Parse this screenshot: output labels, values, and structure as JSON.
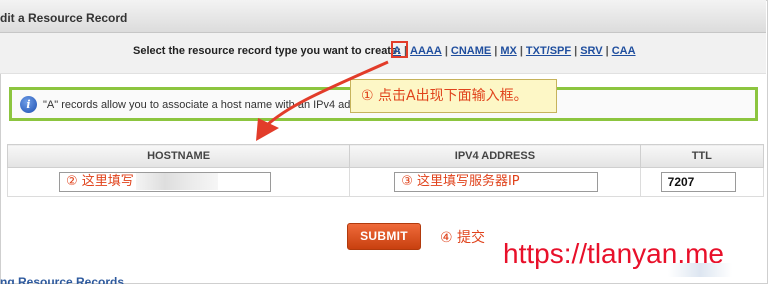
{
  "header": {
    "title": "dit a Resource Record"
  },
  "type_selector": {
    "prompt": "Select the resource record type you want to create:",
    "types": [
      "A",
      "AAAA",
      "CNAME",
      "MX",
      "TXT/SPF",
      "SRV",
      "CAA"
    ],
    "selected": "A"
  },
  "info": {
    "text": "\"A\" records allow you to associate a host name with an IPv4 addr"
  },
  "annotations": {
    "step1": "① 点击A出现下面输入框。",
    "step2": "② 这里填写 www.",
    "step3": "③ 这里填写服务器IP",
    "step4": "④ 提交"
  },
  "table": {
    "columns": [
      "HOSTNAME",
      "IPV4 ADDRESS",
      "TTL"
    ],
    "ttl_value": "7207"
  },
  "submit": {
    "label": "SUBMIT"
  },
  "watermark": "https://tlanyan.me",
  "footer": {
    "link": "ng Resource Records"
  },
  "colors": {
    "accent_red": "#e0431c",
    "link_blue": "#1f4e9e",
    "info_border": "#8cc53f",
    "submit_orange": "#d9501e",
    "watermark_red": "#e8102a"
  }
}
